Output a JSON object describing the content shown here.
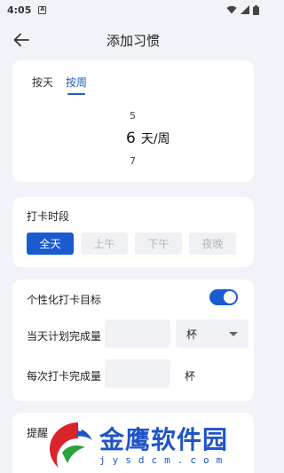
{
  "status_bar": {
    "time": "4:05",
    "app_icon": "A"
  },
  "header": {
    "title": "添加习惯"
  },
  "frequency": {
    "tabs": [
      {
        "label": "按天",
        "active": false
      },
      {
        "label": "按周",
        "active": true
      }
    ],
    "picker": {
      "prev": "5",
      "current": "6",
      "unit": "天/周",
      "next": "7"
    }
  },
  "time_period": {
    "title": "打卡时段",
    "options": [
      {
        "label": "全天",
        "active": true
      },
      {
        "label": "上午",
        "active": false
      },
      {
        "label": "下午",
        "active": false
      },
      {
        "label": "夜晚",
        "active": false
      }
    ]
  },
  "goal": {
    "title": "个性化打卡目标",
    "toggle_on": true,
    "daily_label": "当天计划完成量",
    "daily_value": "",
    "daily_unit": "杯",
    "per_checkin_label": "每次打卡完成量",
    "per_checkin_value": "",
    "per_checkin_unit": "杯"
  },
  "reminder": {
    "title": "提醒"
  },
  "watermark": {
    "text": "金鹰软件园",
    "url": "jysdcm.com"
  },
  "colors": {
    "accent": "#1a5bd0",
    "background": "#f1f3f8"
  }
}
